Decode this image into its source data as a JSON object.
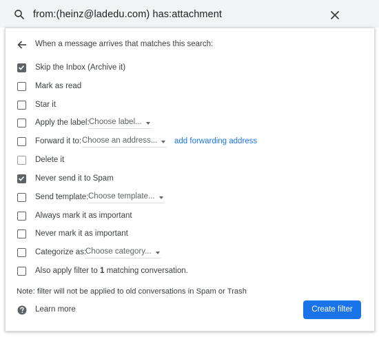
{
  "search": {
    "query": "from:(heinz@ladedu.com) has:attachment"
  },
  "header": {
    "text": "When a message arrives that matches this search:"
  },
  "options": {
    "skip_inbox": {
      "label": "Skip the Inbox (Archive it)",
      "checked": true
    },
    "mark_read": {
      "label": "Mark as read",
      "checked": false
    },
    "star": {
      "label": "Star it",
      "checked": false
    },
    "apply_label": {
      "label": "Apply the label:",
      "dropdown": "Choose label...",
      "checked": false
    },
    "forward": {
      "label": "Forward it to:",
      "dropdown": "Choose an address...",
      "link": "add forwarding address",
      "checked": false
    },
    "delete": {
      "label": "Delete it",
      "checked": false
    },
    "never_spam": {
      "label": "Never send it to Spam",
      "checked": true
    },
    "send_template": {
      "label": "Send template:",
      "dropdown": "Choose template...",
      "checked": false
    },
    "always_important": {
      "label": "Always mark it as important",
      "checked": false
    },
    "never_important": {
      "label": "Never mark it as important",
      "checked": false
    },
    "categorize": {
      "label": "Categorize as:",
      "dropdown": "Choose category...",
      "checked": false
    },
    "also_apply": {
      "prefix": "Also apply filter to ",
      "count": "1",
      "suffix": " matching conversation.",
      "checked": false
    }
  },
  "note": "Note: filter will not be applied to old conversations in Spam or Trash",
  "footer": {
    "learn_more": "Learn more",
    "create_filter": "Create filter"
  },
  "colors": {
    "accent": "#1a73e8",
    "checkbox": "#5f6368"
  }
}
